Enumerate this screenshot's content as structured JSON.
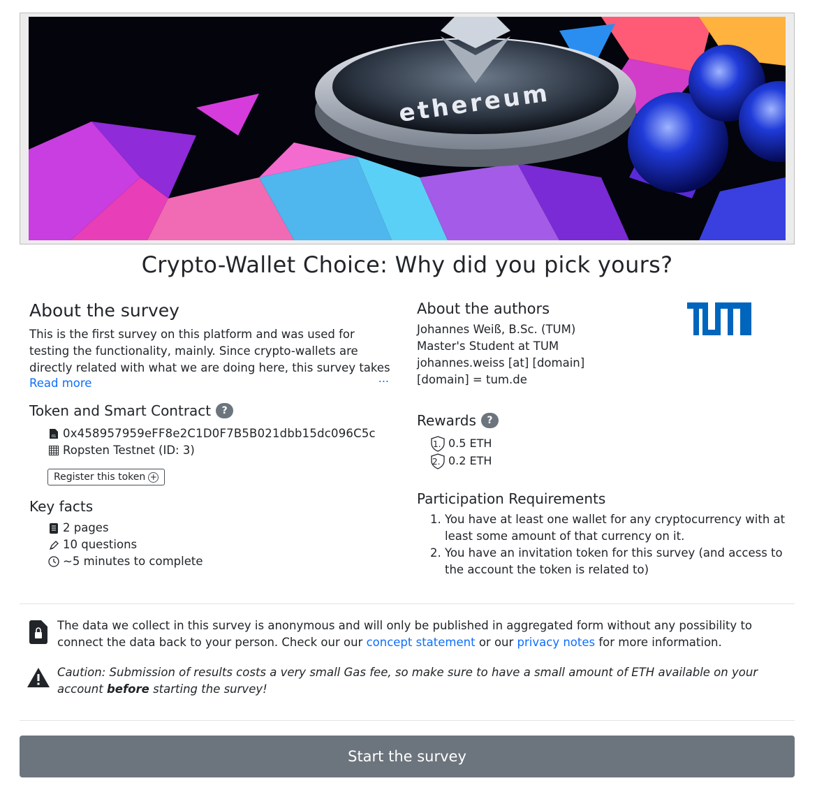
{
  "title": "Crypto-Wallet Choice: Why did you pick yours?",
  "banner": {
    "coin_text": "ethereum"
  },
  "about": {
    "heading": "About the survey",
    "description": "This is the first survey on this platform and was used for testing the functionality, mainly. Since crypto-wallets are directly related with what we are doing here, this survey takes a look at your pr",
    "ellipsis": "...",
    "read_more": "Read more"
  },
  "token": {
    "heading": "Token and Smart Contract",
    "help": "?",
    "address": "0x458957959eFF8e2C1D0F7B5B021dbb15dc096C5c",
    "network": "Ropsten Testnet (ID: 3)",
    "register_label": "Register this token",
    "register_icon": "+"
  },
  "key_facts": {
    "heading": "Key facts",
    "pages": "2 pages",
    "questions": "10 questions",
    "duration": "~5 minutes to complete"
  },
  "authors": {
    "heading": "About the authors",
    "lines": [
      "Johannes Weiß, B.Sc. (TUM)",
      "Master's Student at TUM",
      "johannes.weiss [at] [domain]",
      "[domain] = tum.de"
    ],
    "logo_color": "#0065bd"
  },
  "rewards": {
    "heading": "Rewards",
    "help": "?",
    "items": [
      {
        "rank": "1.",
        "amount": "0.5 ETH"
      },
      {
        "rank": "2.",
        "amount": "0.2 ETH"
      }
    ]
  },
  "requirements": {
    "heading": "Participation Requirements",
    "items": [
      "You have at least one wallet for any cryptocurrency with at least some amount of that currency on it.",
      "You have an invitation token for this survey (and access to the account the token is related to)"
    ]
  },
  "privacy": {
    "text_1": "The data we collect in this survey is anonymous and will only be published in aggregated form without any possibility to connect the data back to your person. Check our our ",
    "link_concept": "concept statement",
    "text_2": " or our ",
    "link_privacy": "privacy notes",
    "text_3": " for more information."
  },
  "caution": {
    "label": "Caution",
    "text_1": ": Submission of results costs a very small Gas fee, so make sure to have a small amount of ETH available on your account ",
    "bold": "before",
    "text_2": " starting the survey!"
  },
  "start_button": "Start the survey",
  "colors": {
    "link": "#0d6efd",
    "button": "#6c757d",
    "badge": "#6c757d"
  }
}
